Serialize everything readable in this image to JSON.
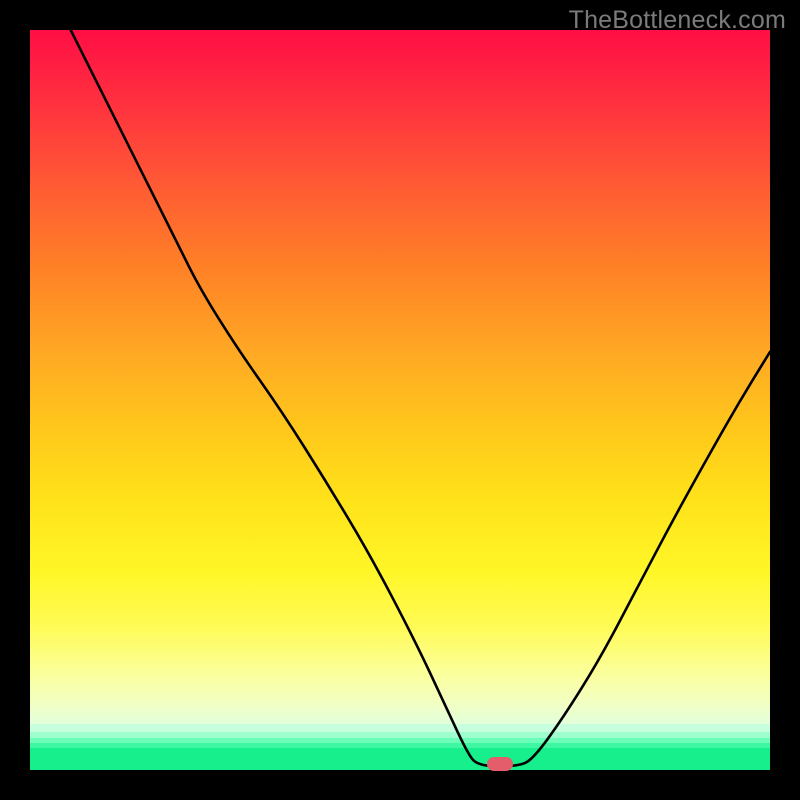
{
  "watermark": "TheBottleneck.com",
  "marker": {
    "x_pct": 63.5,
    "y_pct": 99.5,
    "color": "#e35d6a"
  },
  "chart_data": {
    "type": "line",
    "title": "",
    "xlabel": "",
    "ylabel": "",
    "xlim": [
      0,
      100
    ],
    "ylim": [
      0,
      100
    ],
    "gradient_stops": [
      {
        "pct": 0,
        "color": "#ff0e45"
      },
      {
        "pct": 10,
        "color": "#ff2f3f"
      },
      {
        "pct": 22,
        "color": "#ff5935"
      },
      {
        "pct": 34,
        "color": "#ff8026"
      },
      {
        "pct": 46,
        "color": "#ffa724"
      },
      {
        "pct": 58,
        "color": "#ffc91b"
      },
      {
        "pct": 68,
        "color": "#ffe31a"
      },
      {
        "pct": 78,
        "color": "#fff627"
      },
      {
        "pct": 86,
        "color": "#fffb56"
      },
      {
        "pct": 92,
        "color": "#f2ffc3"
      },
      {
        "pct": 94,
        "color": "#c7ffde"
      },
      {
        "pct": 96,
        "color": "#6cfdb8"
      },
      {
        "pct": 100,
        "color": "#17ef8c"
      }
    ],
    "series": [
      {
        "name": "bottleneck-curve",
        "points": [
          {
            "x": 5.5,
            "y": 100.0
          },
          {
            "x": 10.0,
            "y": 91.0
          },
          {
            "x": 15.0,
            "y": 81.0
          },
          {
            "x": 20.0,
            "y": 71.0
          },
          {
            "x": 23.0,
            "y": 65.0
          },
          {
            "x": 28.0,
            "y": 57.0
          },
          {
            "x": 34.0,
            "y": 48.5
          },
          {
            "x": 40.0,
            "y": 39.0
          },
          {
            "x": 46.0,
            "y": 29.0
          },
          {
            "x": 52.0,
            "y": 17.5
          },
          {
            "x": 56.0,
            "y": 9.0
          },
          {
            "x": 59.0,
            "y": 2.5
          },
          {
            "x": 60.5,
            "y": 0.5
          },
          {
            "x": 66.0,
            "y": 0.5
          },
          {
            "x": 68.0,
            "y": 1.5
          },
          {
            "x": 72.0,
            "y": 7.0
          },
          {
            "x": 77.0,
            "y": 15.0
          },
          {
            "x": 82.0,
            "y": 24.5
          },
          {
            "x": 87.0,
            "y": 34.0
          },
          {
            "x": 92.0,
            "y": 43.0
          },
          {
            "x": 96.0,
            "y": 50.0
          },
          {
            "x": 100.0,
            "y": 56.5
          }
        ]
      }
    ],
    "marker": {
      "x": 63.5,
      "y": 0.5
    }
  }
}
